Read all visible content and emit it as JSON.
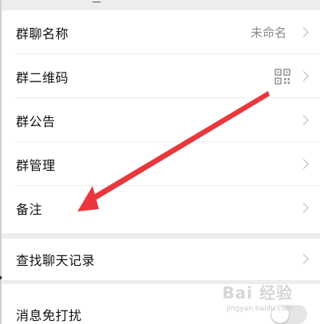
{
  "settings": {
    "group_name": {
      "label": "群聊名称",
      "value": "未命名"
    },
    "group_qr": {
      "label": "群二维码"
    },
    "announcement": {
      "label": "群公告"
    },
    "manage": {
      "label": "群管理"
    },
    "remark": {
      "label": "备注"
    },
    "search_history": {
      "label": "查找聊天记录"
    },
    "mute": {
      "label": "消息免打扰",
      "on": false
    }
  },
  "annotation": {
    "arrow_color": "#e8383d"
  },
  "watermark": {
    "text": "Bai 经验",
    "sub": "jingyan.baidu.com"
  }
}
